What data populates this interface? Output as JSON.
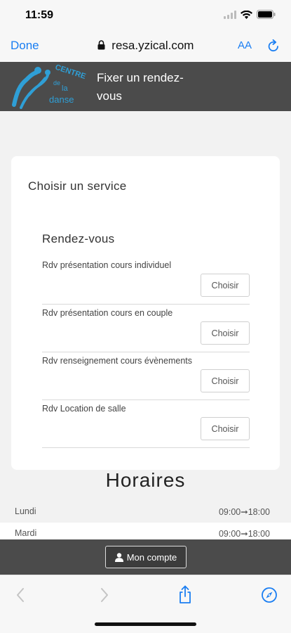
{
  "status_bar": {
    "time": "11:59"
  },
  "browser": {
    "done_label": "Done",
    "url": "resa.yzical.com",
    "text_size_label": "AA"
  },
  "header": {
    "title": "Fixer un rendez-vous",
    "logo_text": [
      "CENTRE",
      "de",
      "la",
      "danse"
    ]
  },
  "card": {
    "title": "Choisir un service",
    "section_title": "Rendez-vous",
    "choose_label": "Choisir",
    "services": [
      {
        "name": "Rdv présentation cours individuel"
      },
      {
        "name": "Rdv présentation cours en couple"
      },
      {
        "name": "Rdv renseignement cours évènements"
      },
      {
        "name": "Rdv Location de salle"
      }
    ]
  },
  "hours": {
    "title": "Horaires",
    "rows": [
      {
        "day": "Lundi",
        "time": "09:00➞18:00"
      },
      {
        "day": "Mardi",
        "time": "09:00➞18:00"
      }
    ]
  },
  "footer": {
    "account_label": "Mon compte"
  },
  "colors": {
    "ios_blue": "#1a7ef2",
    "header_bg": "#4b4b4b",
    "logo_blue": "#2f9fd6"
  }
}
